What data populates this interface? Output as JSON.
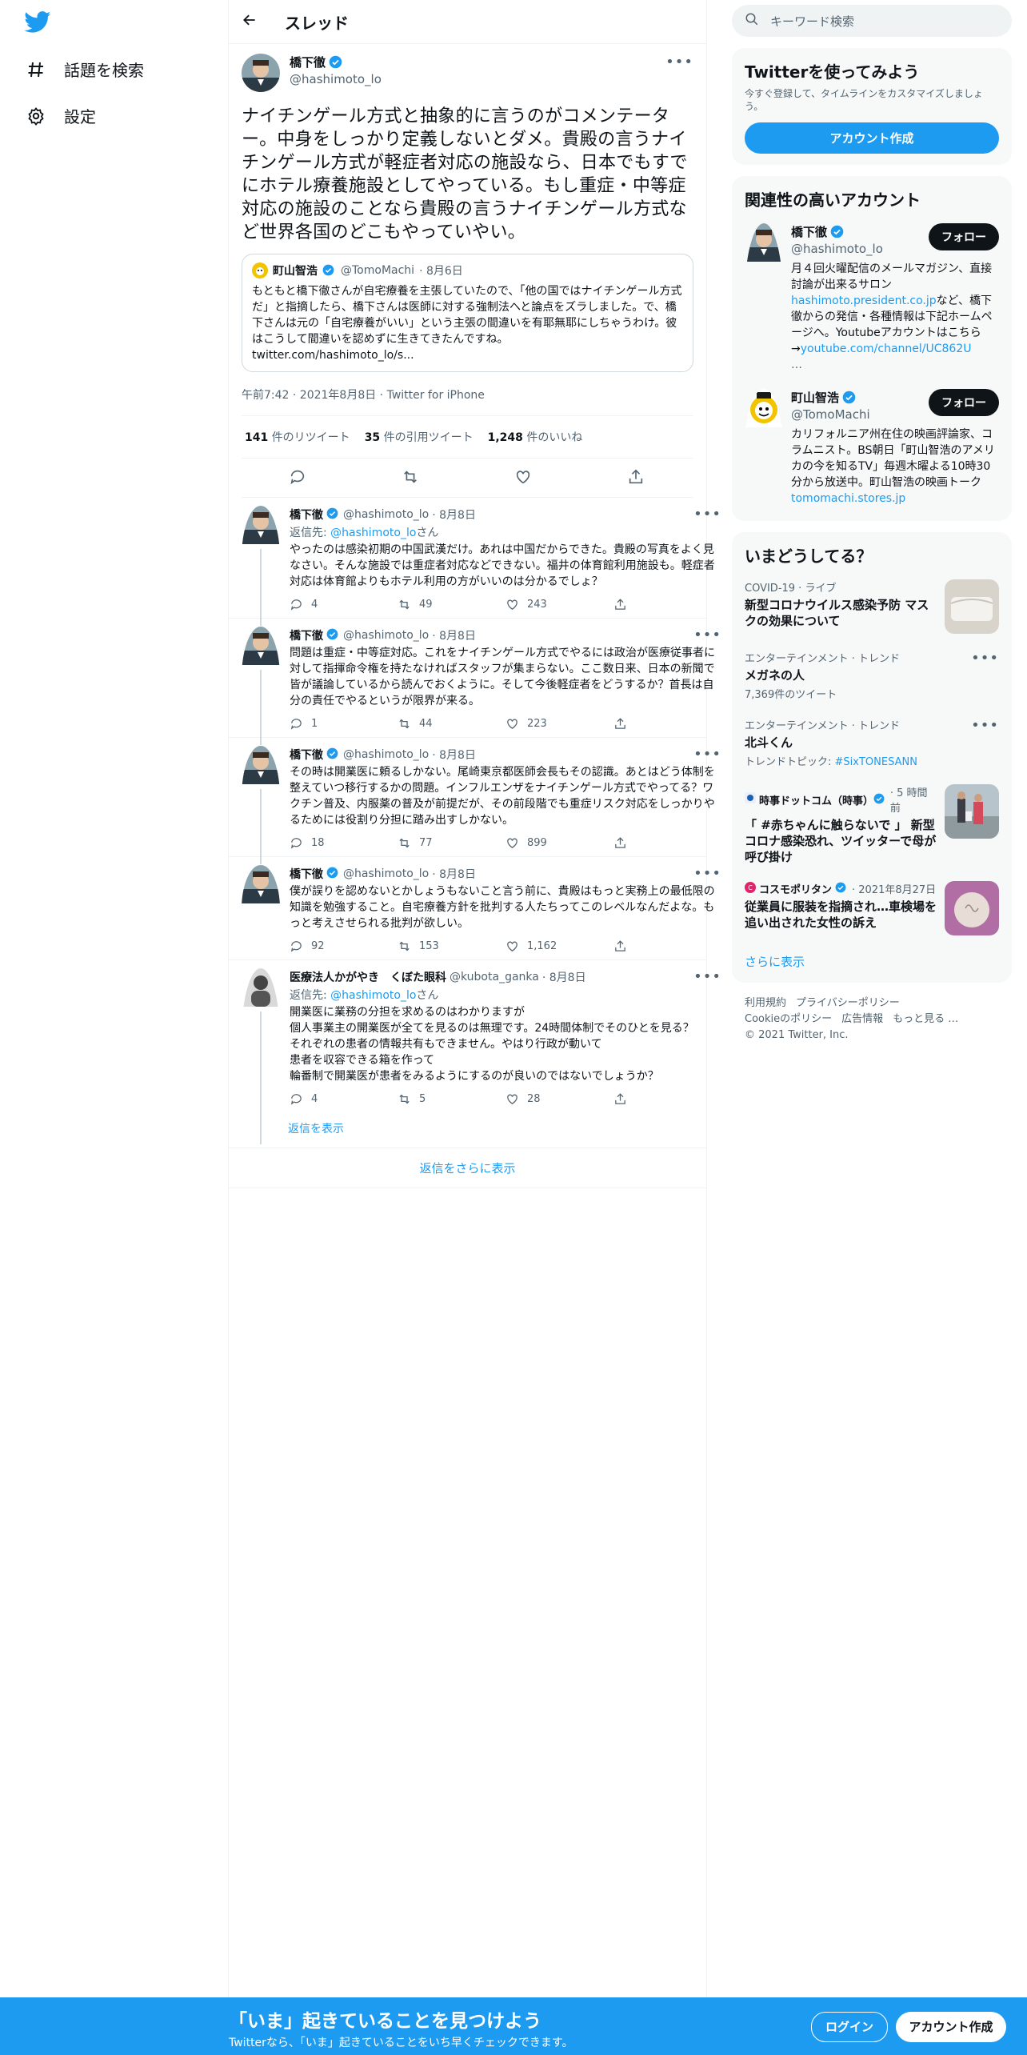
{
  "nav": {
    "explore": "話題を検索",
    "settings": "設定"
  },
  "header": {
    "title": "スレッド"
  },
  "main_tweet": {
    "name": "橋下徹",
    "handle": "@hashimoto_lo",
    "text": "ナイチンゲール方式と抽象的に言うのがコメンテーター。中身をしっかり定義しないとダメ。貴殿の言うナイチンゲール方式が軽症者対応の施設なら、日本でもすでにホテル療養施設としてやっている。もし重症・中等症対応の施設のことなら貴殿の言うナイチンゲール方式など世界各国のどこもやっていやい。",
    "quote": {
      "name": "町山智浩",
      "handle": "@TomoMachi",
      "date": "· 8月6日",
      "text": "もともと橋下徹さんが自宅療養を主張していたので、「他の国ではナイチンゲール方式だ」と指摘したら、橋下さんは医師に対する強制法へと論点をズラしました。で、橋下さんは元の「自宅療養がいい」という主張の間違いを有耶無耶にしちゃうわけ。彼はこうして間違いを認めずに生きてきたんですね。",
      "link": "twitter.com/hashimoto_lo/s..."
    },
    "meta": "午前7:42 · 2021年8月8日 · Twitter for iPhone",
    "retweets": "141",
    "retweets_label": "件のリツイート",
    "quotes": "35",
    "quotes_label": "件の引用ツイート",
    "likes": "1,248",
    "likes_label": "件のいいね"
  },
  "replies": [
    {
      "name": "橋下徹",
      "handle": "@hashimoto_lo",
      "date": "· 8月8日",
      "replyto_prefix": "返信先: ",
      "replyto": "@hashimoto_lo",
      "replyto_suffix": "さん",
      "text": "やったのは感染初期の中国武漢だけ。あれは中国だからできた。貴殿の写真をよく見なさい。そんな施設では重症者対応などできない。福井の体育館利用施設も。軽症者対応は体育館よりもホテル利用の方がいいのは分かるでしょ？",
      "reply_count": "4",
      "rt_count": "49",
      "like_count": "243"
    },
    {
      "name": "橋下徹",
      "handle": "@hashimoto_lo",
      "date": "· 8月8日",
      "text": "問題は重症・中等症対応。これをナイチンゲール方式でやるには政治が医療従事者に対して指揮命令権を持たなければスタッフが集まらない。ここ数日来、日本の新聞で皆が議論しているから読んでおくように。そして今後軽症者をどうするか？首長は自分の責任でやるというが限界が来る。",
      "reply_count": "1",
      "rt_count": "44",
      "like_count": "223"
    },
    {
      "name": "橋下徹",
      "handle": "@hashimoto_lo",
      "date": "· 8月8日",
      "text": "その時は開業医に頼るしかない。尾崎東京都医師会長もその認識。あとはどう体制を整えていつ移行するかの問題。インフルエンザをナイチンゲール方式でやってる？ワクチン普及、内服薬の普及が前提だが、その前段階でも重症リスク対応をしっかりやるためには役割り分担に踏み出すしかない。",
      "reply_count": "18",
      "rt_count": "77",
      "like_count": "899"
    },
    {
      "name": "橋下徹",
      "handle": "@hashimoto_lo",
      "date": "· 8月8日",
      "text": "僕が誤りを認めないとかしょうもないこと言う前に、貴殿はもっと実務上の最低限の知識を勉強すること。自宅療養方針を批判する人たちってこのレベルなんだよな。もっと考えさせられる批判が欲しい。",
      "reply_count": "92",
      "rt_count": "153",
      "like_count": "1,162"
    },
    {
      "name": "医療法人かがやき　くぼた眼科",
      "handle": "@kubota_ganka",
      "date": "· 8月8日",
      "replyto_prefix": "返信先: ",
      "replyto": "@hashimoto_lo",
      "replyto_suffix": "さん",
      "text": "開業医に業務の分担を求めるのはわかりますが\n個人事業主の開業医が全てを見るのは無理です。24時間体制でそのひとを見る？\nそれぞれの患者の情報共有もできません。やはり行政が動いて\n患者を収容できる箱を作って\n輪番制で開業医が患者をみるようにするのが良いのではないでしょうか？",
      "reply_count": "4",
      "rt_count": "5",
      "like_count": "28"
    }
  ],
  "show_replies": "返信を表示",
  "show_more_replies": "返信をさらに表示",
  "right": {
    "search_placeholder": "キーワード検索",
    "signup_card": {
      "title": "Twitterを使ってみよう",
      "sub": "今すぐ登録して、タイムラインをカスタマイズしましょう。",
      "button": "アカウント作成"
    },
    "related": {
      "title": "関連性の高いアカウント",
      "accounts": [
        {
          "name": "橋下徹",
          "handle": "@hashimoto_lo",
          "follow": "フォロー",
          "bio_a": "月４回火曜配信のメールマガジン、直接討論が出来るサロン",
          "bio_link1": "hashimoto.president.co.jp",
          "bio_b": "など、橋下徹からの発信・各種情報は下記ホームページへ。Youtubeアカウントはこちら→",
          "bio_link2": "youtube.com/channel/UC862U",
          "bio_c": "…"
        },
        {
          "name": "町山智浩",
          "handle": "@TomoMachi",
          "follow": "フォロー",
          "bio_a": "カリフォルニア州在住の映画評論家、コラムニスト。BS朝日「町山智浩のアメリカの今を知るTV」毎週木曜よる10時30分から放送中。町山智浩の映画トーク ",
          "bio_link1": "tomomachi.stores.jp"
        }
      ]
    },
    "trends": {
      "title": "いまどうしてる？",
      "items": [
        {
          "meta": "COVID-19 · ライブ",
          "title": "新型コロナウイルス感染予防 マスクの効果について"
        },
        {
          "meta": "エンターテインメント · トレンド",
          "title": "メガネの人",
          "sub": "7,369件のツイート"
        },
        {
          "meta": "エンターテインメント · トレンド",
          "title": "北斗くん",
          "sub_prefix": "トレンドトピック: ",
          "sub_link": "#SixTONESANN"
        },
        {
          "meta_name": "時事ドットコム（時事）",
          "meta": "· 5 時間前",
          "title": "「 #赤ちゃんに触らないで 」 新型コロナ感染恐れ、ツイッターで母が呼び掛け"
        },
        {
          "meta_name": "コスモポリタン",
          "meta": "· 2021年8月27日",
          "title": "従業員に服装を指摘され…車検場を追い出された女性の訴え"
        }
      ],
      "more": "さらに表示"
    },
    "footer": {
      "terms": "利用規約",
      "privacy": "プライバシーポリシー",
      "cookies": "Cookieのポリシー",
      "ads": "広告情報",
      "more": "もっと見る …",
      "copyright": "© 2021 Twitter, Inc."
    }
  },
  "bottom_bar": {
    "title": "「いま」起きていることを見つけよう",
    "sub": "Twitterなら、「いま」起きていることをいち早くチェックできます。",
    "login": "ログイン",
    "signup": "アカウント作成"
  },
  "colors": {
    "accent": "#1d9bf0",
    "text": "#0f1419",
    "muted": "#536471"
  }
}
